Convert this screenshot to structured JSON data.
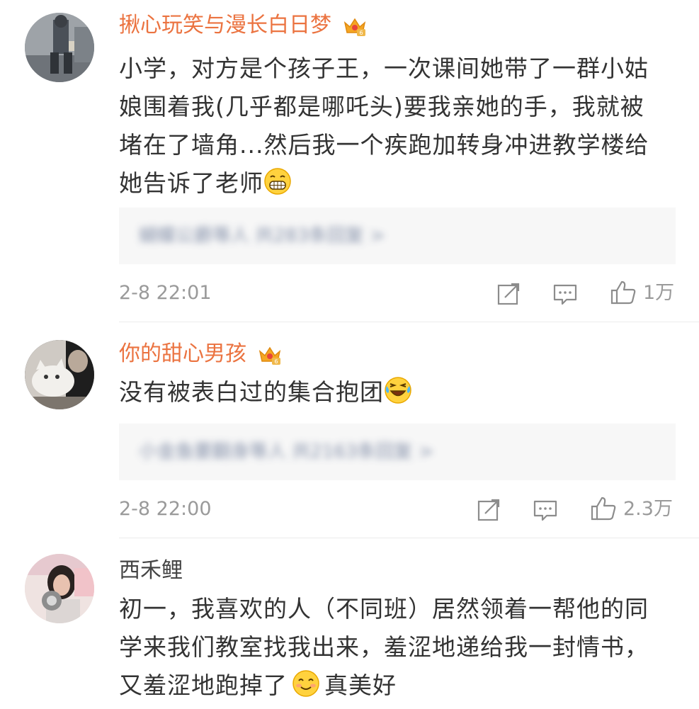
{
  "comments": [
    {
      "username": "揪心玩笑与漫长白日梦",
      "vip": true,
      "avatar": "avatar-person-street",
      "lines": [
        "小学，对方是个孩子王，一次课间她带了一群小姑",
        "娘围着我(几乎都是哪吒头)要我亲她的手，我就被",
        "堵在了墙角...然后我一个疾跑加转身冲进教学楼给",
        "她告诉了老师"
      ],
      "emoji": "grin-emoji",
      "replies_blurred": "蝴蝶公爵等人 共283条回复 >",
      "time": "2-8 22:01",
      "likes": "1万"
    },
    {
      "username": "你的甜心男孩",
      "vip": true,
      "avatar": "avatar-cat",
      "lines": [
        "没有被表白过的集合抱团"
      ],
      "emoji": "laugh-cry-emoji",
      "replies_blurred": "小金鱼要翻身等人 共2163条回复 >",
      "time": "2-8 22:00",
      "likes": "2.3万"
    },
    {
      "username": "西禾鲤",
      "vip": false,
      "avatar": "avatar-girl",
      "lines": [
        "初一，我喜欢的人（不同班）居然领着一帮他的同",
        "学来我们教室找我出来，羞涩地递给我一封情书，",
        "又羞涩地跑掉了"
      ],
      "emoji": "smile-emoji",
      "tail_text": "真美好"
    }
  ],
  "colors": {
    "vip_name": "#eb7340",
    "meta": "#9a9a9a",
    "reply_bg": "#f7f7f7",
    "reply_link": "#6f7d9b"
  }
}
